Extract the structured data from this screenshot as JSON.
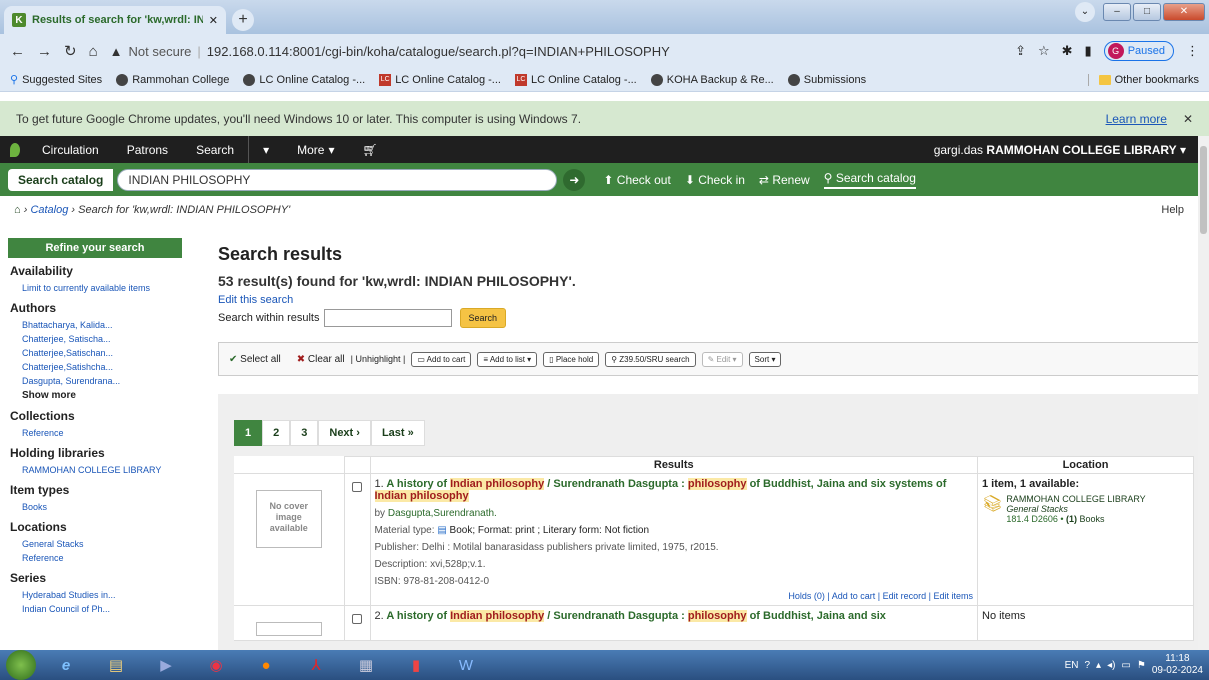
{
  "browser": {
    "tab_title": "Results of search for 'kw,wrdl: IN",
    "url_prefix": "Not secure",
    "url": "192.168.0.114:8001/cgi-bin/koha/catalogue/search.pl?q=INDIAN+PHILOSOPHY",
    "profile": "Paused",
    "profile_letter": "G",
    "bookmarks": [
      "Suggested Sites",
      "Rammohan College",
      "LC Online Catalog -...",
      "LC Online Catalog -...",
      "LC Online Catalog -...",
      "KOHA Backup & Re...",
      "Submissions"
    ],
    "other_bookmarks": "Other bookmarks",
    "infobar_text": "To get future Google Chrome updates, you'll need Windows 10 or later. This computer is using Windows 7.",
    "infobar_link": "Learn more"
  },
  "koha_nav": {
    "items": [
      "Circulation",
      "Patrons",
      "Search",
      "More"
    ],
    "user": "gargi.das",
    "library": "RAMMOHAN COLLEGE LIBRARY"
  },
  "search_bar": {
    "label": "Search catalog",
    "query": "INDIAN PHILOSOPHY",
    "actions": [
      "Check out",
      "Check in",
      "Renew",
      "Search catalog"
    ]
  },
  "breadcrumb": {
    "catalog": "Catalog",
    "current": "Search for 'kw,wrdl: INDIAN PHILOSOPHY'",
    "help": "Help"
  },
  "sidebar": {
    "title": "Refine your search",
    "sections": [
      {
        "heading": "Availability",
        "items": [
          "Limit to currently available items"
        ]
      },
      {
        "heading": "Authors",
        "items": [
          "Bhattacharya, Kalida...",
          "Chatterjee, Satischa...",
          "Chatterjee,Satischan...",
          "Chatterjee,Satishcha...",
          "Dasgupta, Surendrana..."
        ],
        "more": "Show more"
      },
      {
        "heading": "Collections",
        "items": [
          "Reference"
        ]
      },
      {
        "heading": "Holding libraries",
        "items": [
          "RAMMOHAN COLLEGE LIBRARY"
        ]
      },
      {
        "heading": "Item types",
        "items": [
          "Books"
        ]
      },
      {
        "heading": "Locations",
        "items": [
          "General Stacks",
          "Reference"
        ]
      },
      {
        "heading": "Series",
        "items": [
          "Hyderabad Studies in...",
          "Indian Council of Ph..."
        ]
      }
    ]
  },
  "main": {
    "title": "Search results",
    "count": "53 result(s) found for 'kw,wrdl: INDIAN PHILOSOPHY'.",
    "edit": "Edit this search",
    "within_label": "Search within results",
    "search_btn": "Search",
    "toolbar": [
      "Select all",
      "Clear all",
      "| Unhighlight |",
      "Add to cart",
      "Add to list",
      "Place hold",
      "Z39.50/SRU search",
      "Edit",
      "Sort"
    ],
    "pager": [
      "1",
      "2",
      "3",
      "Next ›",
      "Last »"
    ],
    "columns": [
      "Results",
      "Location"
    ],
    "no_cover": "No cover image available",
    "result1": {
      "num": "1.",
      "t1": "A history of ",
      "h1": "Indian philosophy",
      "t2": " / Surendranath Dasgupta : ",
      "h2": "philosophy",
      "t3": " of Buddhist, Jaina and six systems of ",
      "h3": "Indian philosophy",
      "by_label": "by",
      "author": "Dasgupta,Surendranath.",
      "material_label": "Material type:",
      "material_value": "Book; Format: print ; Literary form: Not fiction",
      "publisher_label": "Publisher:",
      "publisher_value": "Delhi : Motilal banarasidass publishers private limited, 1975, r2015.",
      "description_label": "Description:",
      "description_value": "xvi,528p;v.1.",
      "isbn_label": "ISBN:",
      "isbn_value": "978-81-208-0412-0",
      "actions": "Holds (0) | Add to cart | Edit record | Edit items",
      "loc_summary": "1 item, 1 available:",
      "loc_library": "RAMMOHAN COLLEGE LIBRARY",
      "loc_stack": "General Stacks",
      "loc_call": "181.4 D2606 •",
      "loc_count": "(1)",
      "loc_type": "Books"
    },
    "result2": {
      "num": "2.",
      "t1": "A history of ",
      "h1": "Indian philosophy",
      "t2": " / Surendranath Dasgupta : ",
      "h2": "philosophy",
      "t3": " of Buddhist, Jaina and six",
      "loc": "No items"
    }
  },
  "taskbar": {
    "lang": "EN",
    "time": "11:18",
    "date": "09-02-2024"
  }
}
